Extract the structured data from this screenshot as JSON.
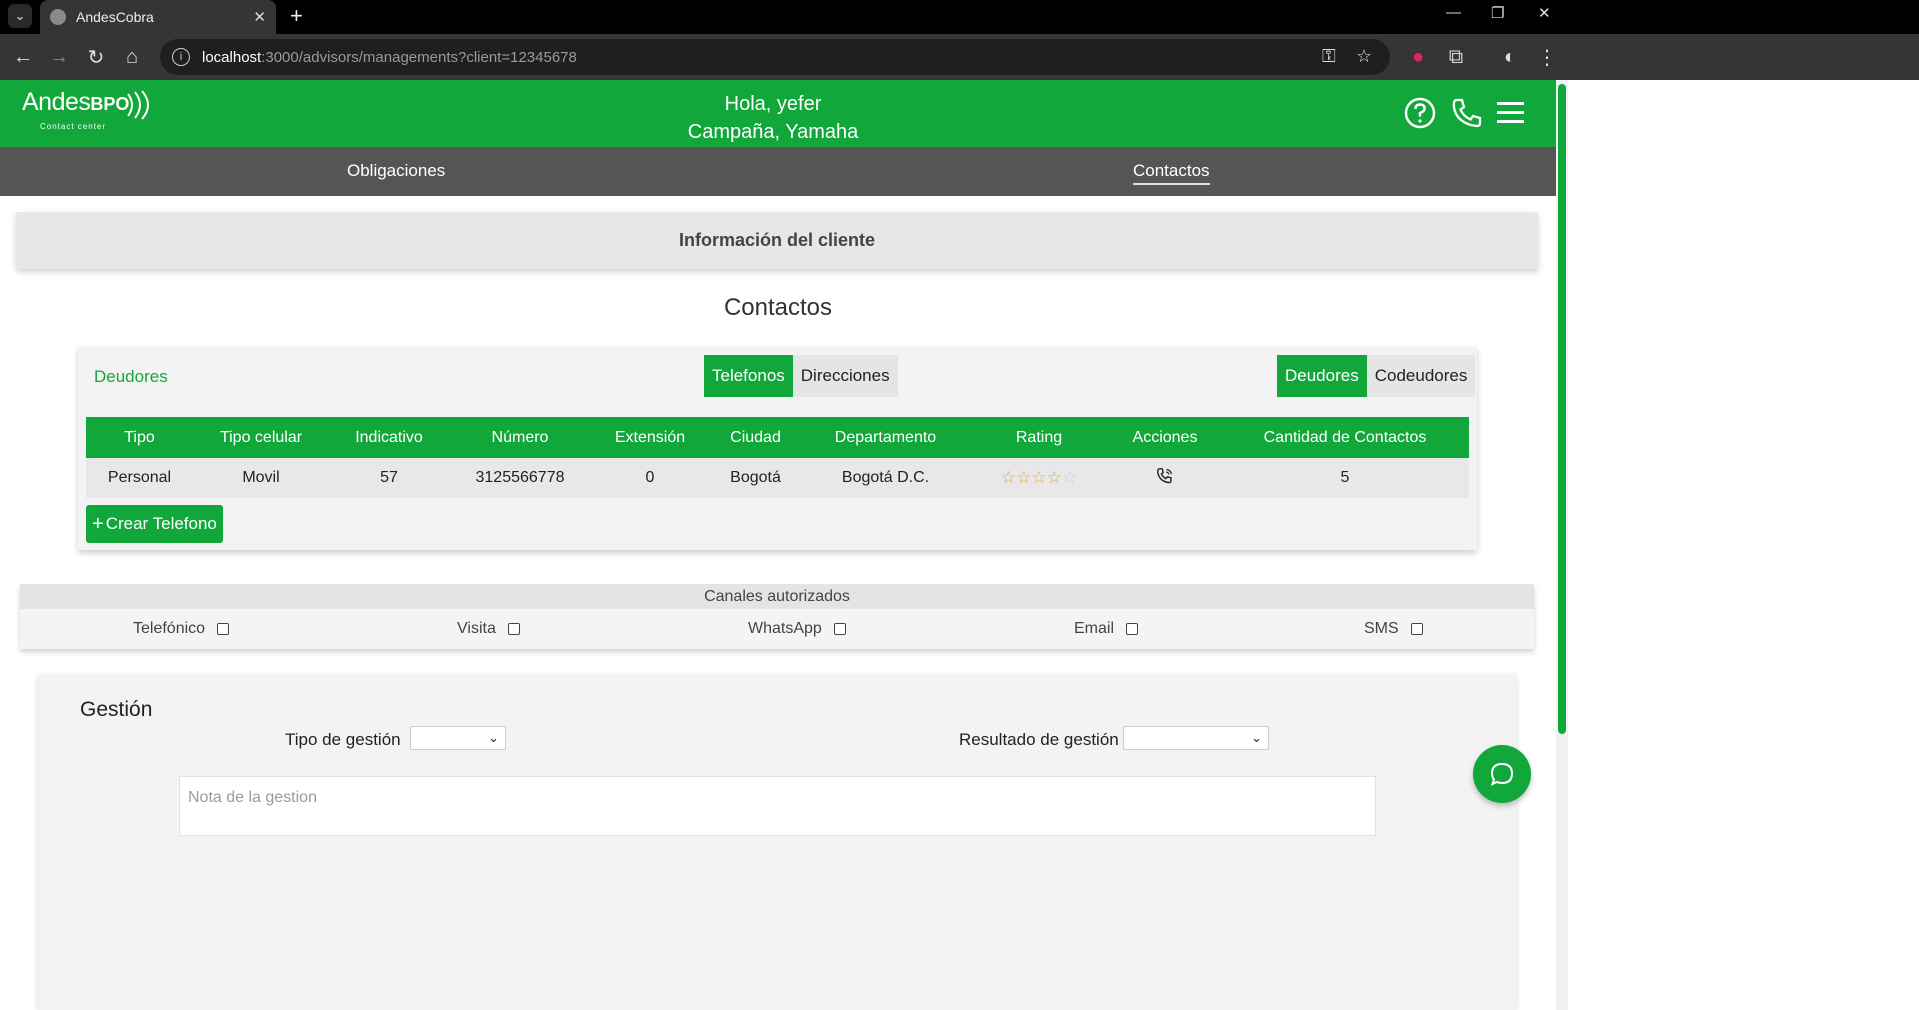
{
  "browser": {
    "tab_title": "AndesCobra",
    "url_host": "localhost",
    "url_path": ":3000/advisors/managements?client=12345678"
  },
  "header": {
    "logo_text": "Andes",
    "logo_bpo": "BPO",
    "logo_sub": "Contact center",
    "greeting": "Hola, yefer",
    "campaign": "Campaña, Yamaha"
  },
  "subnav": {
    "obligaciones": "Obligaciones",
    "contactos": "Contactos"
  },
  "info_bar": {
    "label": "Información del cliente"
  },
  "contactos": {
    "title": "Contactos",
    "deudores_label": "Deudores",
    "toggle_tel": "Telefonos",
    "toggle_dir": "Direcciones",
    "toggle_deud": "Deudores",
    "toggle_codeud": "Codeudores",
    "columns": [
      "Tipo",
      "Tipo celular",
      "Indicativo",
      "Número",
      "Extensión",
      "Ciudad",
      "Departamento",
      "Rating",
      "Acciones",
      "Cantidad de Contactos"
    ],
    "rows": [
      {
        "tipo": "Personal",
        "tipo_celular": "Movil",
        "indicativo": "57",
        "numero": "3125566778",
        "extension": "0",
        "ciudad": "Bogotá",
        "departamento": "Bogotá D.C.",
        "rating": 4,
        "rating_max": 5,
        "cantidad": "5"
      }
    ],
    "crear_label": "Crear Telefono"
  },
  "canales": {
    "title": "Canales autorizados",
    "items": [
      "Telefónico",
      "Visita",
      "WhatsApp",
      "Email",
      "SMS"
    ]
  },
  "gestion": {
    "title": "Gestión",
    "tipo_label": "Tipo de gestión",
    "resultado_label": "Resultado de gestión",
    "nota_placeholder": "Nota de la gestion"
  },
  "colors": {
    "brand_green": "#12a73a",
    "subnav_gray": "#555555",
    "star": "#e8a823"
  }
}
